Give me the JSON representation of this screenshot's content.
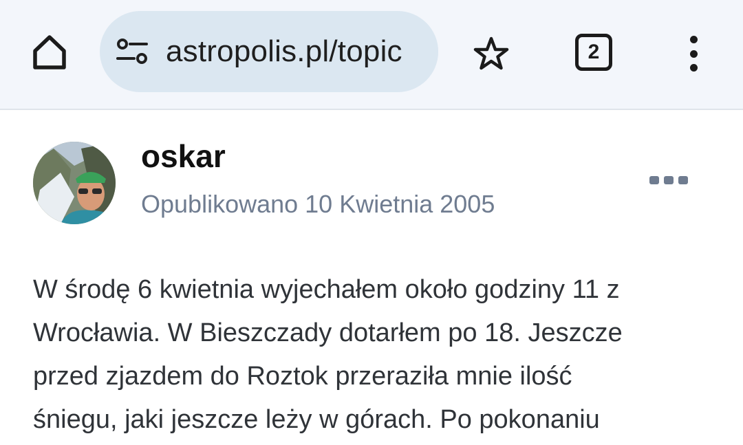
{
  "browser": {
    "url_display": "astropolis.pl/topic",
    "tab_count": "2",
    "icons": {
      "home": "home-icon",
      "site_settings": "tune-icon",
      "bookmark": "star-icon",
      "menu": "more-vert-icon"
    }
  },
  "post": {
    "author": "oskar",
    "published": "Opublikowano 10 Kwietnia 2005",
    "body": "W środę 6 kwietnia wyjechałem około godziny 11 z\nWrocławia. W Bieszczady dotarłem po 18. Jeszcze\nprzed zjazdem do Roztok przeraziła mnie ilość\nśniegu, jaki jeszcze leży w górach. Po pokonaniu"
  },
  "colors": {
    "toolbar_bg": "#f3f6fb",
    "urlbar_bg": "#dbe7f1",
    "meta_text": "#6f7c90",
    "body_text": "#2f3338"
  }
}
